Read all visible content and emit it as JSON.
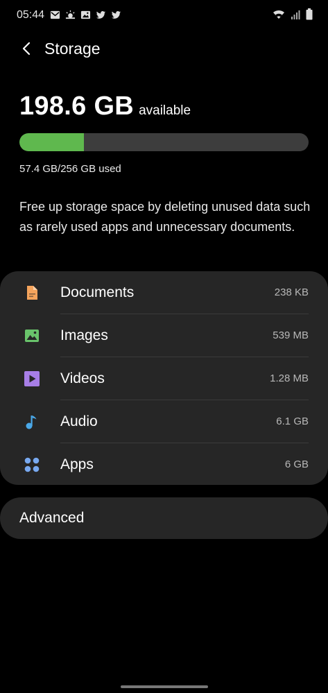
{
  "status_bar": {
    "time": "05:44",
    "notification_icons": [
      "mail-icon",
      "weather-icon",
      "gallery-icon",
      "twitter-icon",
      "twitter-icon"
    ],
    "system_icons": [
      "wifi-icon",
      "signal-icon",
      "battery-icon"
    ]
  },
  "header": {
    "title": "Storage",
    "back_icon": "chevron-left-icon"
  },
  "storage": {
    "available_amount": "198.6 GB",
    "available_label": "available",
    "used_text": "57.4 GB/256 GB used",
    "used_fraction": 0.224,
    "bar_color": "#5fb84e",
    "description": "Free up storage space by deleting unused data such as rarely used apps and unnecessary documents."
  },
  "categories": [
    {
      "label": "Documents",
      "size": "238 KB",
      "icon": "document-icon",
      "color": "#f5a45c"
    },
    {
      "label": "Images",
      "size": "539 MB",
      "icon": "image-icon",
      "color": "#69c36b"
    },
    {
      "label": "Videos",
      "size": "1.28 MB",
      "icon": "video-icon",
      "color": "#a77ee6"
    },
    {
      "label": "Audio",
      "size": "6.1 GB",
      "icon": "music-note-icon",
      "color": "#4aa8e8"
    },
    {
      "label": "Apps",
      "size": "6 GB",
      "icon": "apps-grid-icon",
      "color": "#78a9f0"
    }
  ],
  "advanced": {
    "label": "Advanced"
  }
}
